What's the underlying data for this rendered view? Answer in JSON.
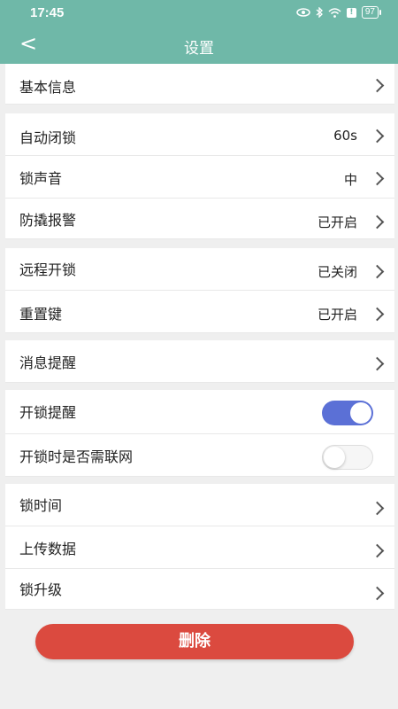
{
  "status_bar": {
    "time": "17:45",
    "battery": "97",
    "alert": "!"
  },
  "header": {
    "back_glyph": "<",
    "title": "设置"
  },
  "settings": {
    "basic_info": {
      "label": "基本信息"
    },
    "auto_lock": {
      "label": "自动闭锁",
      "value": "60s"
    },
    "lock_sound": {
      "label": "锁声音",
      "value": "中"
    },
    "anti_pry_alarm": {
      "label": "防撬报警",
      "value": "已开启"
    },
    "remote_unlock": {
      "label": "远程开锁",
      "value": "已关闭"
    },
    "reset_key": {
      "label": "重置键",
      "value": "已开启"
    },
    "message_reminder": {
      "label": "消息提醒"
    },
    "unlock_reminder": {
      "label": "开锁提醒",
      "enabled": true
    },
    "unlock_network": {
      "label": "开锁时是否需联网",
      "enabled": false
    },
    "lock_time": {
      "label": "锁时间"
    },
    "upload_data": {
      "label": "上传数据"
    },
    "lock_upgrade": {
      "label": "锁升级"
    }
  },
  "delete_button": {
    "label": "删除"
  },
  "colors": {
    "header": "#6fb8a8",
    "toggle_on": "#5b70d6",
    "delete": "#db4a3f"
  },
  "icons": [
    "eye-icon",
    "bluetooth-icon",
    "wifi-icon",
    "alert-icon",
    "battery-icon",
    "back-arrow-icon",
    "chevron-right-icon"
  ]
}
